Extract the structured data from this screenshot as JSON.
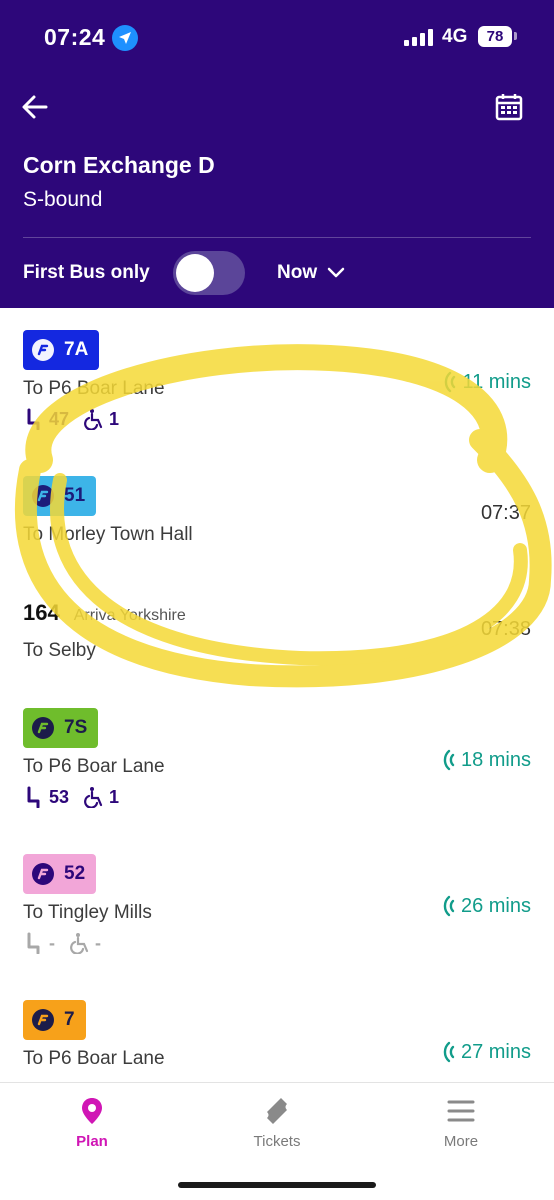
{
  "status_bar": {
    "time": "07:24",
    "network": "4G",
    "battery": "78"
  },
  "header": {
    "stop_name": "Corn Exchange D",
    "direction": "S-bound",
    "filter_label": "First Bus only",
    "time_selector": "Now"
  },
  "departures": [
    {
      "route": "7A",
      "badge_color": "#1428e0",
      "badge_text_color": "#ffffff",
      "destination": "To P6 Boar Lane",
      "seats": "47",
      "wheelchair": "1",
      "eta": "11 mins",
      "live": true
    },
    {
      "route": "51",
      "badge_color": "#3db4e8",
      "badge_text_color": "#1c1c7a",
      "destination": "To Morley Town Hall",
      "eta": "07:37",
      "live": false
    },
    {
      "route": "164",
      "operator": "Arriva Yorkshire",
      "destination": "To Selby",
      "eta": "07:38",
      "live": false
    },
    {
      "route": "7S",
      "badge_color": "#6fbd2c",
      "badge_text_color": "#1c1c4a",
      "destination": "To P6 Boar Lane",
      "seats": "53",
      "wheelchair": "1",
      "eta": "18 mins",
      "live": true
    },
    {
      "route": "52",
      "badge_color": "#f2a6d8",
      "badge_text_color": "#2d077a",
      "destination": "To Tingley Mills",
      "seats": "-",
      "wheelchair": "-",
      "eta": "26 mins",
      "live": true
    },
    {
      "route": "7",
      "badge_color": "#f7a11a",
      "badge_text_color": "#1c1c4a",
      "destination": "To P6 Boar Lane",
      "eta": "27 mins",
      "live": true
    }
  ],
  "tabs": [
    {
      "label": "Plan",
      "icon": "location-pin-icon",
      "active": true
    },
    {
      "label": "Tickets",
      "icon": "ticket-icon",
      "active": false
    },
    {
      "label": "More",
      "icon": "menu-icon",
      "active": false
    }
  ],
  "colors": {
    "header_bg": "#2d077a",
    "live_eta": "#119c8a",
    "active_tab": "#d016b5",
    "highlight": "#f5d936"
  }
}
